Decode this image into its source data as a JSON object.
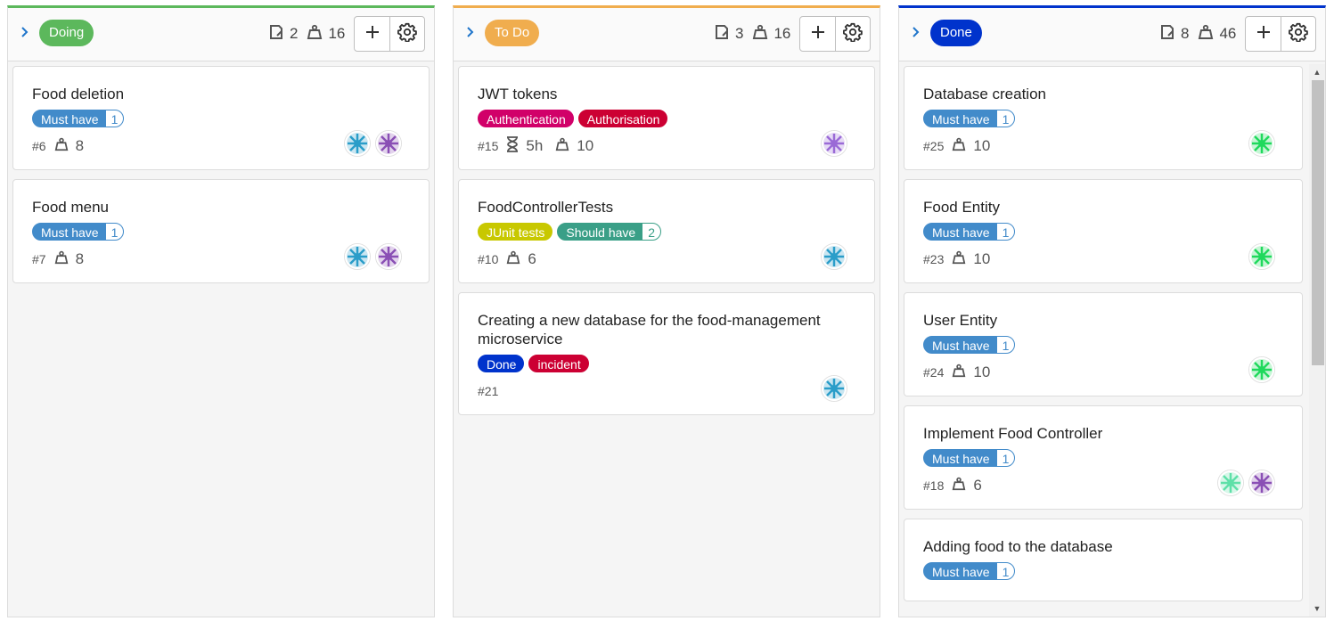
{
  "columns": [
    {
      "label": "Doing",
      "label_color": "#5cb85c",
      "top_color": "#5cb85c",
      "issue_count": "2",
      "weight": "16",
      "cards": [
        {
          "title": "Food deletion",
          "tags": [
            {
              "name": "Must have",
              "value": "1",
              "color": "#428bca"
            }
          ],
          "number": "#6",
          "time": "",
          "weight": "8",
          "avatars": [
            "avatar-teal",
            "avatar-purple"
          ]
        },
        {
          "title": "Food menu",
          "tags": [
            {
              "name": "Must have",
              "value": "1",
              "color": "#428bca"
            }
          ],
          "number": "#7",
          "time": "",
          "weight": "8",
          "avatars": [
            "avatar-teal",
            "avatar-purple"
          ]
        }
      ]
    },
    {
      "label": "To Do",
      "label_color": "#f0ad4e",
      "top_color": "#f0ad4e",
      "issue_count": "3",
      "weight": "16",
      "cards": [
        {
          "title": "JWT tokens",
          "tags": [
            {
              "name": "Authentication",
              "value": "",
              "color": "#d10069"
            },
            {
              "name": "Authorisation",
              "value": "",
              "color": "#cc0033"
            }
          ],
          "number": "#15",
          "time": "5h",
          "weight": "10",
          "avatars": [
            "avatar-violet"
          ]
        },
        {
          "title": "FoodControllerTests",
          "tags": [
            {
              "name": "JUnit tests",
              "value": "",
              "color": "#c8c800"
            },
            {
              "name": "Should have",
              "value": "2",
              "color": "#3a9f87"
            }
          ],
          "number": "#10",
          "time": "",
          "weight": "6",
          "avatars": [
            "avatar-teal"
          ]
        },
        {
          "title": "Creating a new database for the food-management microservice",
          "tags": [
            {
              "name": "Done",
              "value": "",
              "color": "#0033cc"
            },
            {
              "name": "incident",
              "value": "",
              "color": "#cc0033"
            }
          ],
          "number": "#21",
          "time": "",
          "weight": "",
          "avatars": [
            "avatar-teal"
          ]
        }
      ]
    },
    {
      "label": "Done",
      "label_color": "#0033cc",
      "top_color": "#0033cc",
      "issue_count": "8",
      "weight": "46",
      "cards": [
        {
          "title": "Database creation",
          "tags": [
            {
              "name": "Must have",
              "value": "1",
              "color": "#428bca"
            }
          ],
          "number": "#25",
          "time": "",
          "weight": "10",
          "avatars": [
            "avatar-green"
          ]
        },
        {
          "title": "Food Entity",
          "tags": [
            {
              "name": "Must have",
              "value": "1",
              "color": "#428bca"
            }
          ],
          "number": "#23",
          "time": "",
          "weight": "10",
          "avatars": [
            "avatar-green"
          ]
        },
        {
          "title": "User Entity",
          "tags": [
            {
              "name": "Must have",
              "value": "1",
              "color": "#428bca"
            }
          ],
          "number": "#24",
          "time": "",
          "weight": "10",
          "avatars": [
            "avatar-green"
          ]
        },
        {
          "title": "Implement Food Controller",
          "tags": [
            {
              "name": "Must have",
              "value": "1",
              "color": "#428bca"
            }
          ],
          "number": "#18",
          "time": "",
          "weight": "6",
          "avatars": [
            "avatar-mint",
            "avatar-purple"
          ]
        },
        {
          "title": "Adding food to the database",
          "tags": [
            {
              "name": "Must have",
              "value": "1",
              "color": "#428bca"
            }
          ],
          "number": "",
          "time": "",
          "weight": "",
          "avatars": []
        }
      ]
    }
  ],
  "icons": {
    "chevron": "chevron-right-icon",
    "issues": "issues-icon",
    "weight": "weight-icon",
    "time": "hourglass-icon",
    "add": "plus-icon",
    "settings": "gear-icon"
  },
  "avatar_colors": {
    "avatar-teal": "#2a9dc9",
    "avatar-purple": "#8a4fb5",
    "avatar-violet": "#9a6ad6",
    "avatar-green": "#1fd95c",
    "avatar-mint": "#5ee0a8"
  }
}
